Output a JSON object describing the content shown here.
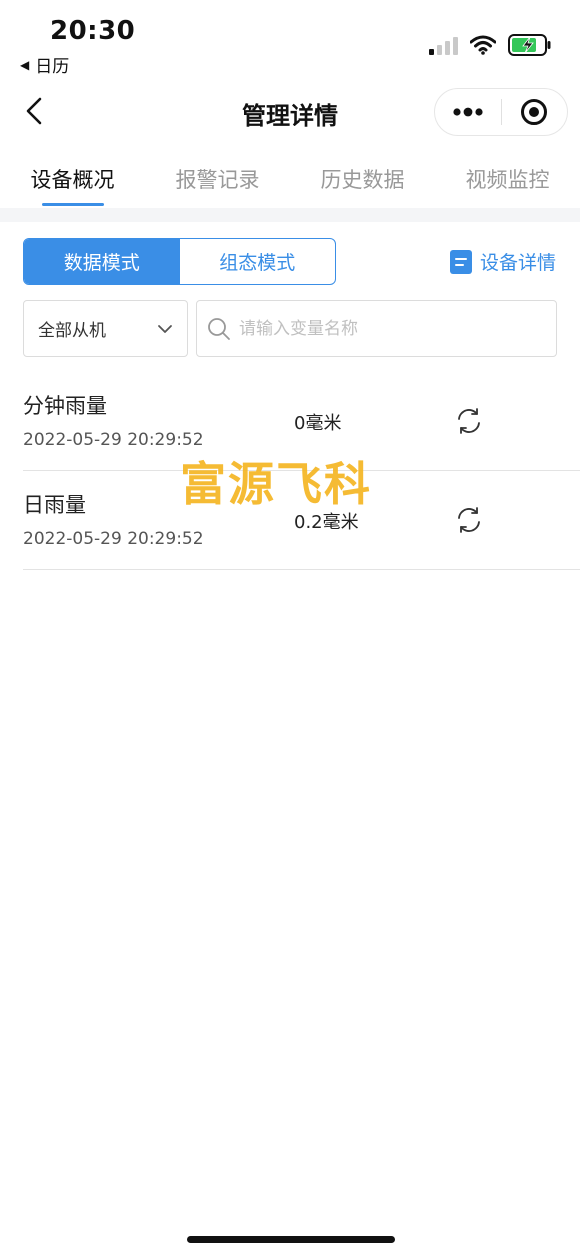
{
  "status_bar": {
    "time": "20:30",
    "back_app_label": "日历",
    "icons": [
      "signal-icon",
      "wifi-icon",
      "battery-charging-icon"
    ]
  },
  "nav": {
    "title": "管理详情",
    "icons": [
      "back-arrow-icon",
      "more-dots-icon",
      "target-icon"
    ]
  },
  "tabs": [
    {
      "label": "设备概况",
      "active": true
    },
    {
      "label": "报警记录",
      "active": false
    },
    {
      "label": "历史数据",
      "active": false
    },
    {
      "label": "视频监控",
      "active": false
    }
  ],
  "mode_switch": {
    "data_mode_label": "数据模式",
    "config_mode_label": "组态模式",
    "active": "data_mode"
  },
  "device_detail_link": "设备详情",
  "filter": {
    "slave_select_value": "全部从机",
    "search_placeholder": "请输入变量名称"
  },
  "variables": [
    {
      "name": "分钟雨量",
      "timestamp": "2022-05-29 20:29:52",
      "value": "0毫米"
    },
    {
      "name": "日雨量",
      "timestamp": "2022-05-29 20:29:52",
      "value": "0.2毫米"
    }
  ],
  "watermark": "富源飞科",
  "colors": {
    "accent": "#3a8ee6",
    "watermark": "#f5b623",
    "battery_charge": "#34c759"
  }
}
